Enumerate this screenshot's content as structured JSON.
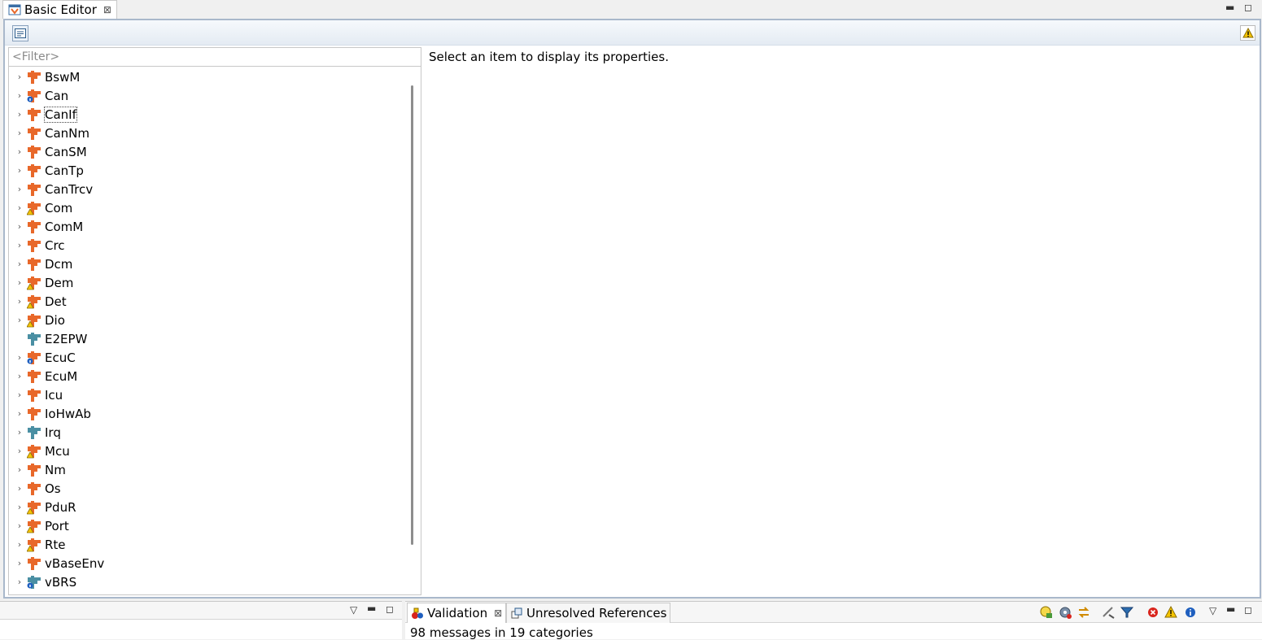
{
  "editor": {
    "tab_title": "Basic Editor",
    "filter_placeholder": "<Filter>",
    "properties_message": "Select an item to display its properties.",
    "modules": [
      {
        "label": "BswM",
        "expandable": true,
        "icon": "module-orange-icon"
      },
      {
        "label": "Can",
        "expandable": true,
        "icon": "module-lock-icon"
      },
      {
        "label": "CanIf",
        "expandable": true,
        "icon": "module-orange-icon",
        "selected": true
      },
      {
        "label": "CanNm",
        "expandable": true,
        "icon": "module-orange-icon"
      },
      {
        "label": "CanSM",
        "expandable": true,
        "icon": "module-orange-icon"
      },
      {
        "label": "CanTp",
        "expandable": true,
        "icon": "module-orange-icon"
      },
      {
        "label": "CanTrcv",
        "expandable": true,
        "icon": "module-orange-icon"
      },
      {
        "label": "Com",
        "expandable": true,
        "icon": "module-warning-icon"
      },
      {
        "label": "ComM",
        "expandable": true,
        "icon": "module-orange-icon"
      },
      {
        "label": "Crc",
        "expandable": true,
        "icon": "module-orange-icon"
      },
      {
        "label": "Dcm",
        "expandable": true,
        "icon": "module-orange-icon"
      },
      {
        "label": "Dem",
        "expandable": true,
        "icon": "module-warning-icon"
      },
      {
        "label": "Det",
        "expandable": true,
        "icon": "module-warning-icon"
      },
      {
        "label": "Dio",
        "expandable": true,
        "icon": "module-warning-icon"
      },
      {
        "label": "E2EPW",
        "expandable": false,
        "icon": "module-teal-icon"
      },
      {
        "label": "EcuC",
        "expandable": true,
        "icon": "module-lock-icon"
      },
      {
        "label": "EcuM",
        "expandable": true,
        "icon": "module-orange-icon"
      },
      {
        "label": "Icu",
        "expandable": true,
        "icon": "module-orange-icon"
      },
      {
        "label": "IoHwAb",
        "expandable": true,
        "icon": "module-orange-icon"
      },
      {
        "label": "Irq",
        "expandable": true,
        "icon": "module-teal-icon"
      },
      {
        "label": "Mcu",
        "expandable": true,
        "icon": "module-warning-icon"
      },
      {
        "label": "Nm",
        "expandable": true,
        "icon": "module-orange-icon"
      },
      {
        "label": "Os",
        "expandable": true,
        "icon": "module-orange-icon"
      },
      {
        "label": "PduR",
        "expandable": true,
        "icon": "module-warning-icon"
      },
      {
        "label": "Port",
        "expandable": true,
        "icon": "module-warning-icon"
      },
      {
        "label": "Rte",
        "expandable": true,
        "icon": "module-warning-icon"
      },
      {
        "label": "vBaseEnv",
        "expandable": true,
        "icon": "module-orange-icon"
      },
      {
        "label": "vBRS",
        "expandable": true,
        "icon": "module-lock-teal-icon"
      }
    ]
  },
  "bottom": {
    "tabs": [
      {
        "label": "Validation",
        "active": true,
        "icon": "validation-icon",
        "closable": true
      },
      {
        "label": "Unresolved References",
        "active": false,
        "icon": "references-icon",
        "closable": false
      }
    ],
    "status": "98 messages in 19 categories"
  },
  "colors": {
    "module_orange": "#e8682a",
    "module_teal": "#4a8fa3",
    "frame_border": "#a9b8cb",
    "warning_yellow": "#f5c400",
    "error_red": "#d9251d",
    "info_blue": "#1f5fbf"
  }
}
